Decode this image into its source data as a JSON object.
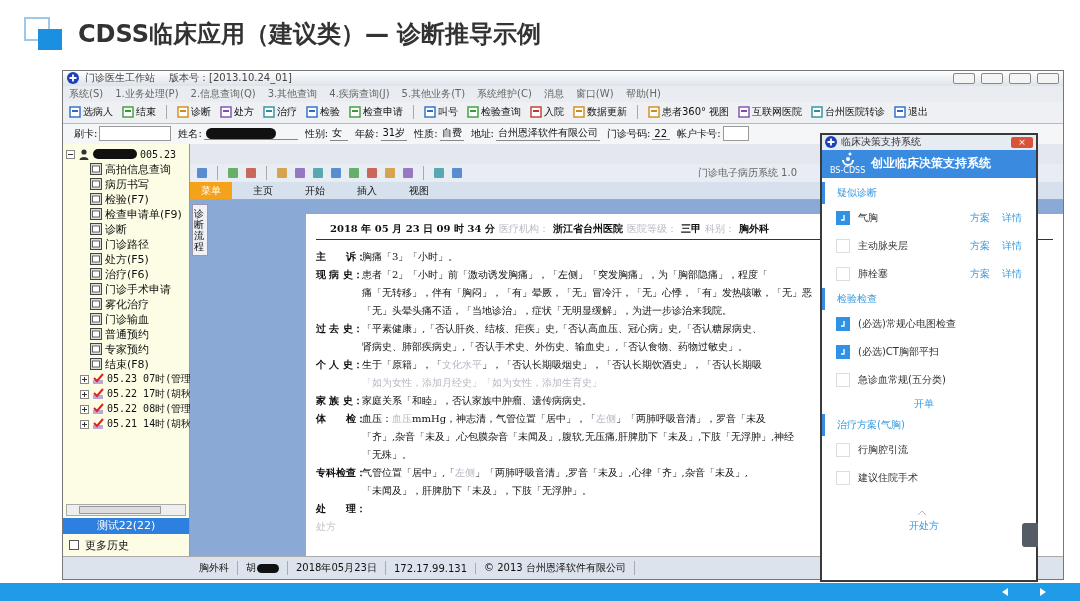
{
  "slide": {
    "title": "CDSS临床应用（建议类）— 诊断推导示例"
  },
  "window": {
    "title": "门诊医生工作站",
    "version": "版本号：[2013.10.24_01]"
  },
  "menu": [
    "系统(S)",
    "1.业务处理(P)",
    "2.信息查询(Q)",
    "3.其他查询",
    "4.疾病查询(J)",
    "5.其他业务(T)",
    "系统维护(C)",
    "消息",
    "窗口(W)",
    "帮助(H)"
  ],
  "toolbar": [
    [
      "选病人",
      "结束"
    ],
    [
      "诊断",
      "处方",
      "治疗",
      "检验",
      "检查申请"
    ],
    [
      "叫号",
      "检验查询",
      "入院",
      "数据更新"
    ],
    [
      "患者360° 视图",
      "互联网医院",
      "台州医院转诊",
      "退出"
    ]
  ],
  "patient": {
    "fields": [
      {
        "label": "刷卡:",
        "kind": "input"
      },
      {
        "label": "姓名:",
        "kind": "redacted"
      },
      {
        "label": "性别:",
        "kind": "value",
        "value": "女"
      },
      {
        "label": "年龄:",
        "kind": "value",
        "value": "31岁"
      },
      {
        "label": "性质:",
        "kind": "value",
        "value": "自费"
      },
      {
        "label": "地址:",
        "kind": "value",
        "value": "台州恩泽软件有限公司"
      },
      {
        "label": "门诊号码:",
        "kind": "value",
        "value": "22"
      },
      {
        "label": "帐户卡号:",
        "kind": "input"
      }
    ]
  },
  "tree": {
    "root": "005.23",
    "children": [
      "高拍信息查询",
      "病历书写",
      "检验(F7)",
      "检查申请单(F9)",
      "诊断",
      "门诊路径",
      "处方(F5)",
      "治疗(F6)",
      "门诊手术申请",
      "雾化治疗",
      "门诊输血",
      "普通预约",
      "专家预约",
      "结束(F8)"
    ],
    "records": [
      {
        "label": "05.23 07时(管理",
        "expanded": false
      },
      {
        "label": "05.22 17时(胡秋",
        "expanded": false
      },
      {
        "label": "05.22 08时(管理",
        "expanded": false
      },
      {
        "label": "05.21 14时(胡秋",
        "expanded": false
      }
    ],
    "selected_patient": "测试22(22)",
    "more_history": {
      "label": "更多历史",
      "checked": false
    }
  },
  "emr": {
    "title": "门诊电子病历系统 1.0",
    "tabs": [
      {
        "label": "菜单",
        "selected": true
      },
      {
        "label": "主页",
        "selected": false
      },
      {
        "label": "开始",
        "selected": false
      },
      {
        "label": "插入",
        "selected": false
      },
      {
        "label": "视图",
        "selected": false
      }
    ],
    "side_tab": "诊断流程",
    "header": [
      {
        "text": "2018 年 05 月 23 日  09 时 34 分",
        "muted": false
      },
      {
        "text": "医疗机构：",
        "muted": true
      },
      {
        "text": "浙江省台州医院",
        "muted": false
      },
      {
        "text": "医院等级：",
        "muted": true
      },
      {
        "text": "三甲",
        "muted": false
      },
      {
        "text": "科别：",
        "muted": true
      },
      {
        "text": "胸外科",
        "muted": false
      }
    ],
    "sections": [
      {
        "label": "主　　诉：",
        "lines": [
          [
            {
              "text": "胸痛「3」「小时」。",
              "muted": false
            }
          ]
        ]
      },
      {
        "label": "现 病 史：",
        "lines": [
          [
            {
              "text": "患者「2」「小时」前「激动诱发胸痛」，「左侧」「突发胸痛」，为「胸部隐痛」，程度「",
              "muted": false
            }
          ],
          [
            {
              "text": "痛「无转移」，伴有「胸闷」，「有」晕厥，「无」冒冷汗，「无」心悸，「有」发热咳嗽，「无」恶",
              "muted": false
            }
          ],
          [
            {
              "text": "「无」头晕头痛不适，「当地诊治」，症状「无明显缓解」，为进一步诊治来我院。",
              "muted": false
            }
          ]
        ]
      },
      {
        "label": "过 去 史：",
        "lines": [
          [
            {
              "text": "「平素健康」,「否认肝炎、结核、疟疾」史,「否认高血压、冠心病」史,「否认糖尿病史、",
              "muted": false
            }
          ],
          [
            {
              "text": "肾病史、肺部疾病史」,「否认手术史、外伤史、输血史」,「否认食物、药物过敏史」。",
              "muted": false
            }
          ]
        ]
      },
      {
        "label": "个 人 史：",
        "lines": [
          [
            {
              "text": "生于「原籍」，「",
              "muted": false
            },
            {
              "text": "文化水平",
              "muted": true
            },
            {
              "text": "」，「否认长期吸烟史」，「否认长期饮酒史」，「否认长期吸",
              "muted": false
            }
          ],
          [
            {
              "text": "「如为女性，添加月经史」「如为女性，添加生育史」",
              "muted": true
            }
          ]
        ]
      },
      {
        "label": "家 族 史：",
        "lines": [
          [
            {
              "text": "家庭关系「和睦」，否认家族中肿瘤、遗传病病史。",
              "muted": false
            }
          ]
        ]
      },
      {
        "label": "体　　检：",
        "lines": [
          [
            {
              "text": "血压：",
              "muted": false
            },
            {
              "text": "血压",
              "muted": true
            },
            {
              "text": "mmHg，神志清，气管位置「居中」，「",
              "muted": false
            },
            {
              "text": "左侧",
              "muted": true
            },
            {
              "text": "」「两肺呼吸音清」，罗音「未及",
              "muted": false
            }
          ],
          [
            {
              "text": "「齐」,杂音「未及」,心包膜杂音「未闻及」,腹软,无压痛,肝脾肋下「未及」,下肢「无浮肿」,神经",
              "muted": false
            }
          ],
          [
            {
              "text": "「无殊」。",
              "muted": false
            }
          ]
        ]
      },
      {
        "label": "专科检查：",
        "lines": [
          [
            {
              "text": "气管位置「居中」,「",
              "muted": false
            },
            {
              "text": "左侧",
              "muted": true
            },
            {
              "text": "」「两肺呼吸音清」,罗音「未及」,心律「齐」,杂音「未及」,",
              "muted": false
            }
          ],
          [
            {
              "text": "「未闻及」，肝脾肋下「未及」，下肢「无浮肿」。",
              "muted": false
            }
          ]
        ]
      },
      {
        "label": "处　　理："
      }
    ],
    "placeholder": "处方",
    "status": [
      {
        "text": "胸外科",
        "kind": "text"
      },
      {
        "text": "胡",
        "kind": "redacted"
      },
      {
        "text": "2018年05月23日",
        "kind": "text"
      },
      {
        "text": "172.17.99.131",
        "kind": "text"
      },
      {
        "text": "© 2013 台州恩泽软件有限公司",
        "kind": "text"
      }
    ]
  },
  "cdss": {
    "window_title": "临床决策支持系统",
    "close": "×",
    "title": "创业临床决策支持系统",
    "logo_caption": "BS-CDSS",
    "groups": [
      {
        "title": "疑似诊断",
        "items": [
          {
            "label": "气胸",
            "checked": true,
            "actions": [
              "方案",
              "详情"
            ]
          },
          {
            "label": "主动脉夹层",
            "checked": false,
            "actions": [
              "方案",
              "详情"
            ]
          },
          {
            "label": "肺栓塞",
            "checked": false,
            "actions": [
              "方案",
              "详情"
            ]
          }
        ]
      },
      {
        "title": "检验检查",
        "items": [
          {
            "label": "(必选)常规心电图检查",
            "checked": true
          },
          {
            "label": "(必选)CT胸部平扫",
            "checked": true
          },
          {
            "label": "急诊血常规(五分类)",
            "checked": false
          }
        ],
        "link": "开单"
      },
      {
        "title": "治疗方案(气胸)",
        "items": [
          {
            "label": "行胸腔引流",
            "checked": false
          },
          {
            "label": "建议住院手术",
            "checked": false
          }
        ],
        "link": "开处方"
      }
    ]
  }
}
